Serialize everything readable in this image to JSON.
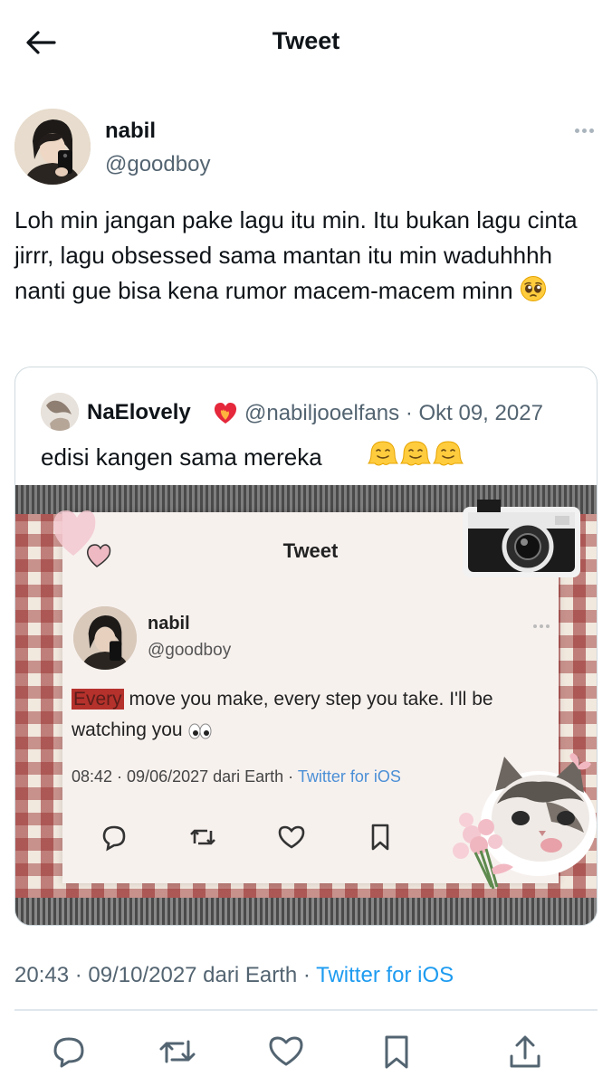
{
  "header": {
    "title": "Tweet",
    "back_icon": "arrow-left-icon"
  },
  "author": {
    "name": "nabil",
    "handle": "@goodboy",
    "more_icon": "more-horizontal-icon"
  },
  "tweet": {
    "text": "Loh min jangan pake lagu itu min. Itu bukan lagu cinta jirrr, lagu obsessed sama mantan itu min waduhhhh nanti gue bisa kena rumor macem-macem minn",
    "emoji": "pleading-face-icon"
  },
  "quote": {
    "name": "NaElovely",
    "name_emoji": "heart-on-fire-icon",
    "handle": "@nabiljooelfans",
    "separator": "·",
    "date": "Okt 09, 2027",
    "text": "edisi kangen sama mereka",
    "emojis": [
      "melting-face-icon",
      "melting-face-icon",
      "melting-face-icon"
    ],
    "media": {
      "title": "Tweet",
      "name": "nabil",
      "handle": "@goodboy",
      "text_highlight": "Every",
      "text_rest": " move you make, every step you take. I'll be watching you",
      "text_emoji": "eyes-icon",
      "time": "08:42 · 09/06/2027 dari Earth · ",
      "source": "Twitter for iOS",
      "decorations": [
        "camera-sticker",
        "cat-sticker",
        "heart-sticker"
      ]
    }
  },
  "meta": {
    "time": "20:43",
    "sep1": " · ",
    "date": "09/10/2027",
    "origin": " dari Earth",
    "sep2": " · ",
    "source": "Twitter for iOS"
  },
  "actions": [
    "reply-icon",
    "retweet-icon",
    "like-icon",
    "bookmark-icon",
    "share-icon"
  ],
  "colors": {
    "accent": "#1d9bf0",
    "secondary_text": "#536471",
    "border": "#cfd9de"
  }
}
